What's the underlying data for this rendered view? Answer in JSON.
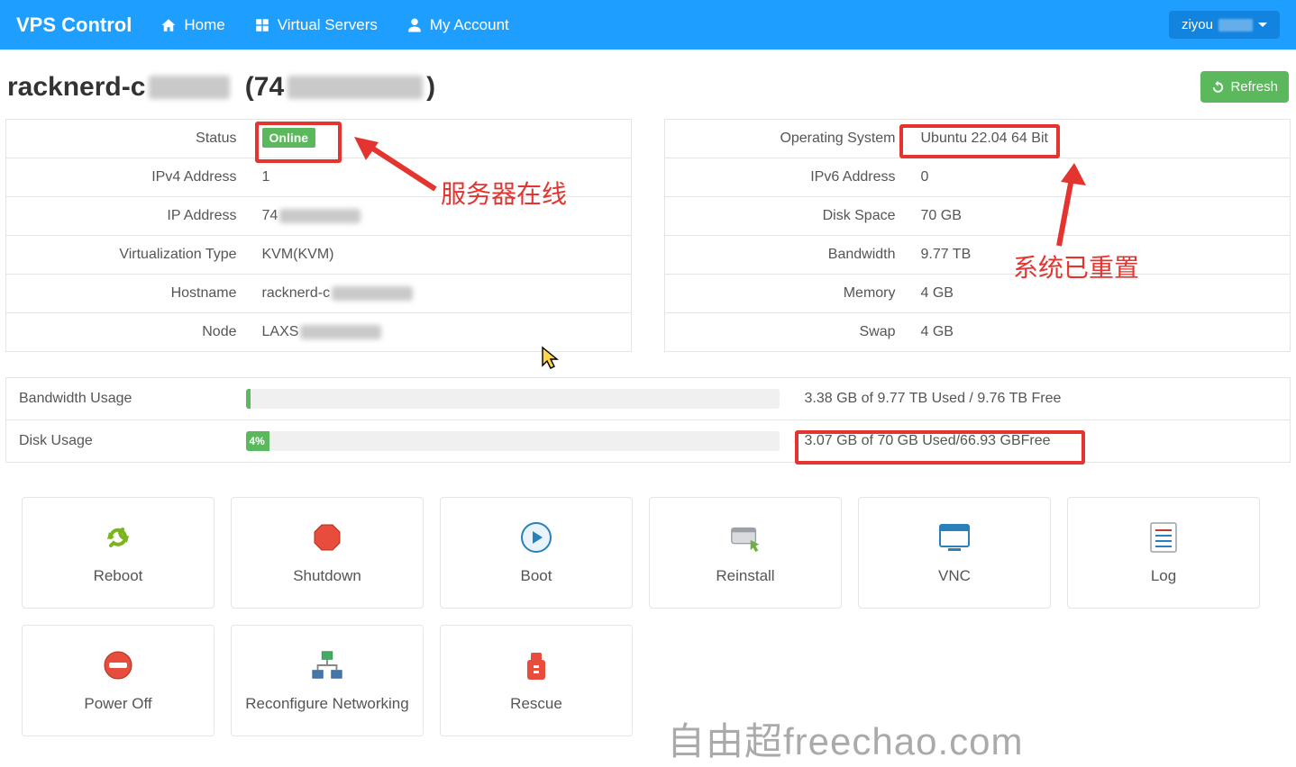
{
  "nav": {
    "brand": "VPS Control",
    "home": "Home",
    "virtual_servers": "Virtual Servers",
    "my_account": "My Account",
    "user": "ziyou"
  },
  "title": {
    "prefix": "racknerd-c",
    "ip_prefix": "(74",
    "ip_suffix": ")"
  },
  "refresh_label": "Refresh",
  "left": [
    {
      "label": "Status",
      "value": "Online",
      "badge": true
    },
    {
      "label": "IPv4 Address",
      "value": "1"
    },
    {
      "label": "IP Address",
      "value": "74",
      "blur": true
    },
    {
      "label": "Virtualization Type",
      "value": "KVM(KVM)"
    },
    {
      "label": "Hostname",
      "value": "racknerd-c",
      "blur": true
    },
    {
      "label": "Node",
      "value": "LAXS",
      "blur": true
    }
  ],
  "right": [
    {
      "label": "Operating System",
      "value": "Ubuntu 22.04 64 Bit"
    },
    {
      "label": "IPv6 Address",
      "value": "0"
    },
    {
      "label": "Disk Space",
      "value": "70 GB"
    },
    {
      "label": "Bandwidth",
      "value": "9.77 TB"
    },
    {
      "label": "Memory",
      "value": "4 GB"
    },
    {
      "label": "Swap",
      "value": "4 GB"
    }
  ],
  "usage": {
    "bandwidth": {
      "label": "Bandwidth Usage",
      "text": "3.38 GB of 9.77 TB Used / 9.76 TB Free",
      "percent": ""
    },
    "disk": {
      "label": "Disk Usage",
      "text": "3.07 GB of 70 GB Used/66.93 GBFree",
      "percent": "4%"
    }
  },
  "actions": [
    "Reboot",
    "Shutdown",
    "Boot",
    "Reinstall",
    "VNC",
    "Log",
    "Power Off",
    "Reconfigure Networking",
    "Rescue"
  ],
  "annotations": {
    "online": "服务器在线",
    "reset": "系统已重置",
    "watermark": "自由超freechao.com"
  }
}
